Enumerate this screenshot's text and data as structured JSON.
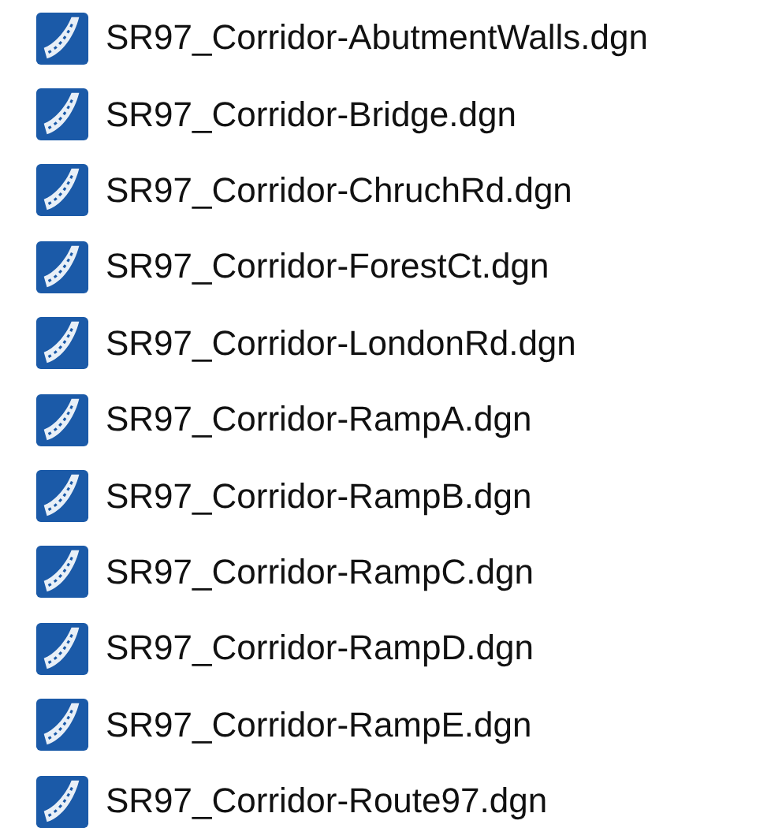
{
  "files": [
    {
      "name": "SR97_Corridor-AbutmentWalls.dgn"
    },
    {
      "name": "SR97_Corridor-Bridge.dgn"
    },
    {
      "name": "SR97_Corridor-ChruchRd.dgn"
    },
    {
      "name": "SR97_Corridor-ForestCt.dgn"
    },
    {
      "name": "SR97_Corridor-LondonRd.dgn"
    },
    {
      "name": "SR97_Corridor-RampA.dgn"
    },
    {
      "name": "SR97_Corridor-RampB.dgn"
    },
    {
      "name": "SR97_Corridor-RampC.dgn"
    },
    {
      "name": "SR97_Corridor-RampD.dgn"
    },
    {
      "name": "SR97_Corridor-RampE.dgn"
    },
    {
      "name": "SR97_Corridor-Route97.dgn"
    }
  ]
}
